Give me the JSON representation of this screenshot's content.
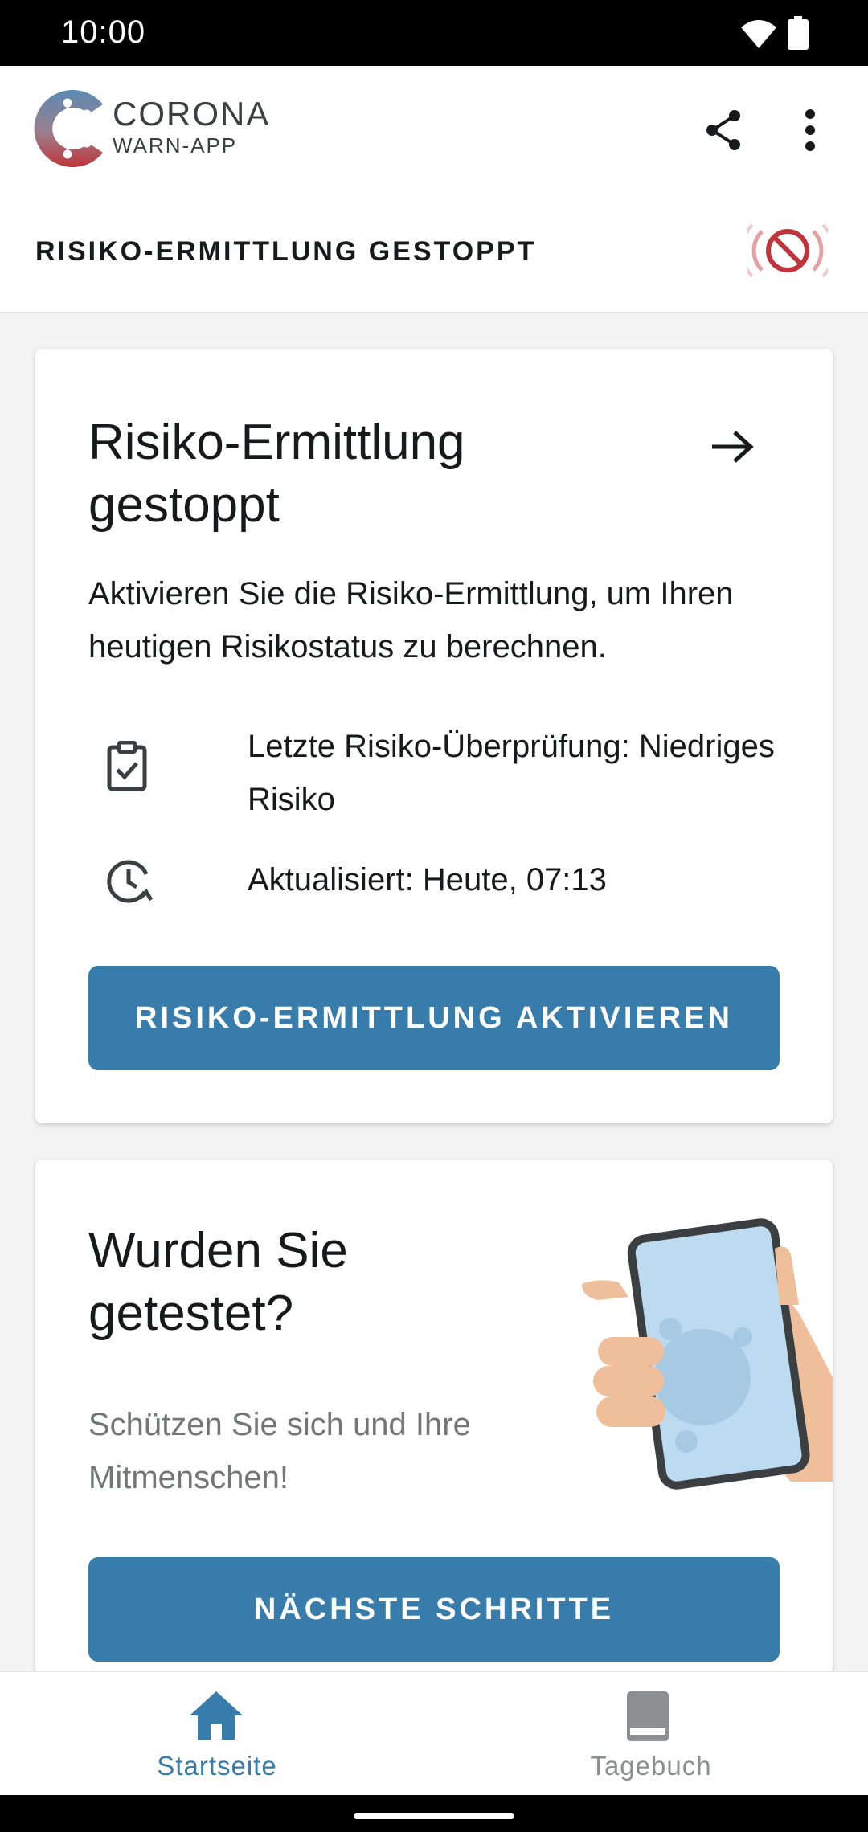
{
  "status_bar": {
    "time": "10:00"
  },
  "app_bar": {
    "logo_title": "CORONA",
    "logo_subtitle": "WARN-APP",
    "icons": [
      "share-icon",
      "more-vert-icon"
    ],
    "banner_title": "RISIKO-ERMITTLUNG GESTOPPT",
    "banner_icon": "tracing-off-icon"
  },
  "risk_card": {
    "title": "Risiko-Ermittlung gestoppt",
    "body": "Aktivieren Sie die Risiko-Ermittlung, um Ihren heutigen Risikostatus zu berechnen.",
    "last_check": "Letzte Risiko-Überprüfung: Niedriges Risiko",
    "updated": "Aktualisiert: Heute, 07:13",
    "button": "RISIKO-ERMITTLUNG AKTIVIEREN"
  },
  "test_card": {
    "title": "Wurden Sie getestet?",
    "body": "Schützen Sie sich und Ihre Mitmenschen!",
    "button": "NÄCHSTE SCHRITTE"
  },
  "bottom_nav": {
    "items": [
      {
        "label": "Startseite",
        "icon": "home-icon",
        "active": true
      },
      {
        "label": "Tagebuch",
        "icon": "book-icon",
        "active": false
      }
    ]
  },
  "colors": {
    "primary": "#377caa",
    "text": "#17191a",
    "muted": "#737577",
    "logo_red": "#c0353b"
  }
}
